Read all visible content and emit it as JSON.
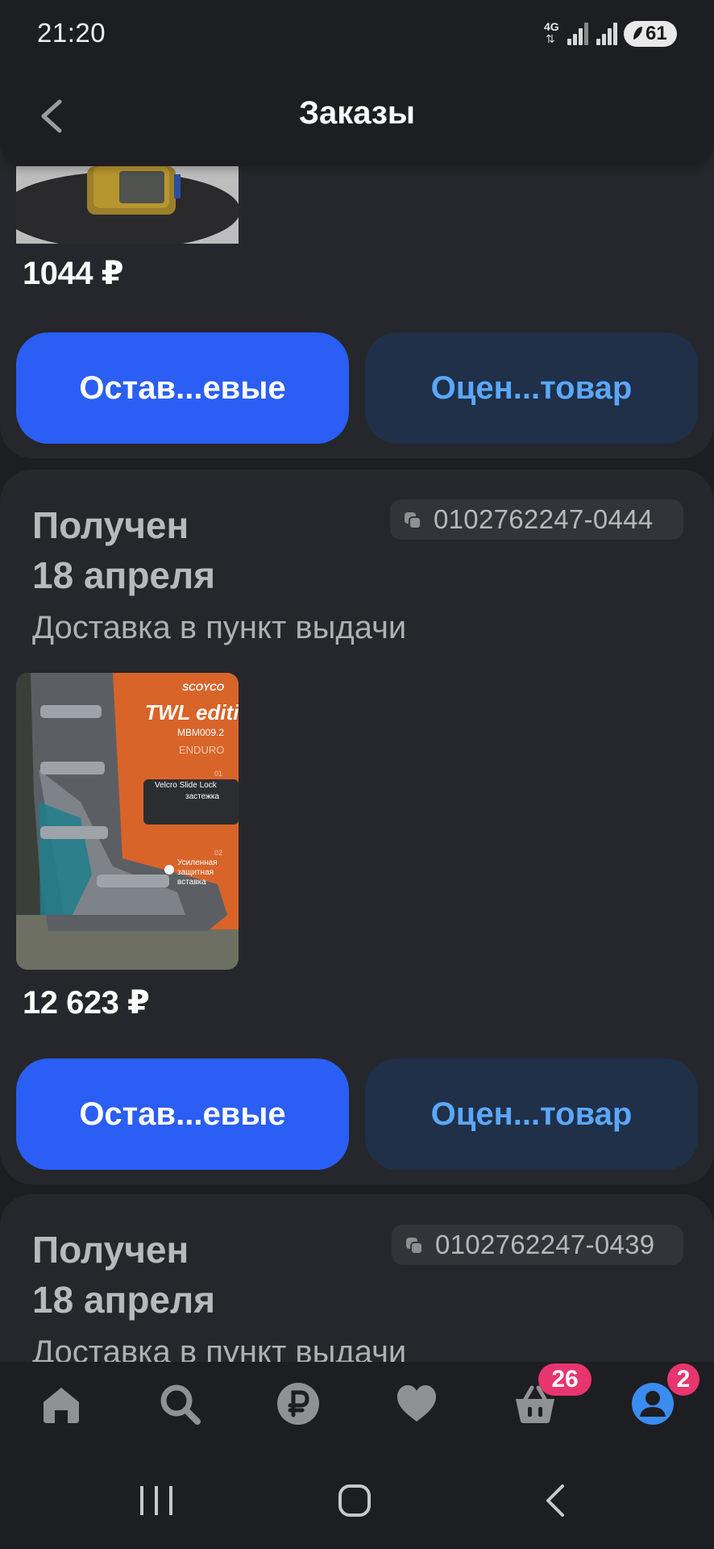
{
  "status_bar": {
    "time": "21:20",
    "network": "4G",
    "battery": "61"
  },
  "header": {
    "title": "Заказы"
  },
  "orders": [
    {
      "price": "1044 ₽",
      "primary_btn": "Остав...евые",
      "secondary_btn": "Оцен...товар"
    },
    {
      "status": "Получен",
      "date": "18 апреля",
      "method": "Доставка в пункт выдачи",
      "order_number": "0102762247-0444",
      "price": "12 623 ₽",
      "primary_btn": "Остав...евые",
      "secondary_btn": "Оцен...товар",
      "product_image_text": {
        "brand": "SCOYCO",
        "edition": "TWL edition",
        "model": "MBM009.2",
        "category": "ENDURO",
        "feature1_num": "01",
        "feature1": "Velcro Slide Lock",
        "feature1_sub": "застежка",
        "feature2_num": "02",
        "feature2": "Усиленная защитная вставка"
      }
    },
    {
      "status": "Получен",
      "date": "18 апреля",
      "method": "Доставка в пункт выдачи",
      "order_number": "0102762247-0439"
    }
  ],
  "bottom_nav": {
    "items": [
      "home-icon",
      "search-icon",
      "ruble-icon",
      "heart-icon",
      "basket-icon",
      "profile-icon"
    ],
    "cart_badge": "26",
    "profile_badge": "2",
    "active_color": "#3b8cf0"
  }
}
